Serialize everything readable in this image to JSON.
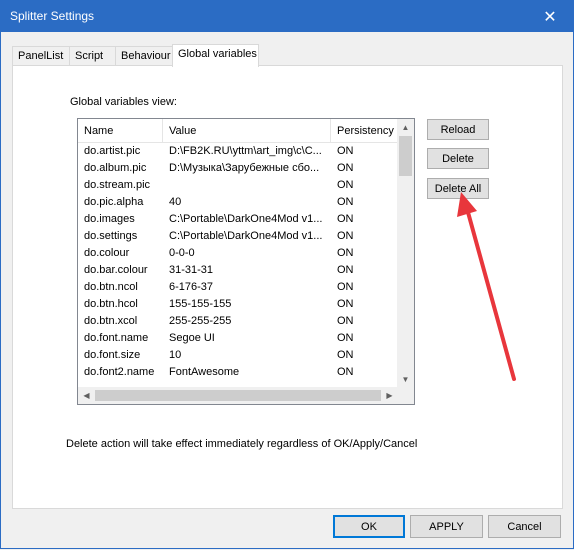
{
  "window": {
    "title": "Splitter Settings"
  },
  "tabs": [
    {
      "label": "PanelList"
    },
    {
      "label": "Script"
    },
    {
      "label": "Behaviour"
    },
    {
      "label": "Global variables"
    }
  ],
  "panel": {
    "view_label": "Global variables view:",
    "note": "Delete action will take effect immediately regardless of OK/Apply/Cancel"
  },
  "list": {
    "columns": [
      "Name",
      "Value",
      "Persistency"
    ],
    "rows": [
      {
        "name": "do.artist.pic",
        "value": "D:\\FB2K.RU\\yttm\\art_img\\c\\C...",
        "persistency": "ON"
      },
      {
        "name": "do.album.pic",
        "value": "D:\\Музыка\\Зарубежные сбо...",
        "persistency": "ON"
      },
      {
        "name": "do.stream.pic",
        "value": "",
        "persistency": "ON"
      },
      {
        "name": "do.pic.alpha",
        "value": "40",
        "persistency": "ON"
      },
      {
        "name": "do.images",
        "value": "C:\\Portable\\DarkOne4Mod v1...",
        "persistency": "ON"
      },
      {
        "name": "do.settings",
        "value": "C:\\Portable\\DarkOne4Mod v1...",
        "persistency": "ON"
      },
      {
        "name": "do.colour",
        "value": "0-0-0",
        "persistency": "ON"
      },
      {
        "name": "do.bar.colour",
        "value": "31-31-31",
        "persistency": "ON"
      },
      {
        "name": "do.btn.ncol",
        "value": "6-176-37",
        "persistency": "ON"
      },
      {
        "name": "do.btn.hcol",
        "value": "155-155-155",
        "persistency": "ON"
      },
      {
        "name": "do.btn.xcol",
        "value": "255-255-255",
        "persistency": "ON"
      },
      {
        "name": "do.font.name",
        "value": "Segoe UI",
        "persistency": "ON"
      },
      {
        "name": "do.font.size",
        "value": "10",
        "persistency": "ON"
      },
      {
        "name": "do.font2.name",
        "value": "FontAwesome",
        "persistency": "ON"
      }
    ]
  },
  "side_buttons": {
    "reload": "Reload",
    "delete": "Delete",
    "delete_all": "Delete All"
  },
  "footer": {
    "ok": "OK",
    "apply": "APPLY",
    "cancel": "Cancel"
  },
  "icons": {
    "close": "close-icon",
    "scroll_up": "arrow-up-icon",
    "scroll_down": "arrow-down-icon",
    "scroll_left": "arrow-left-icon",
    "scroll_right": "arrow-right-icon"
  },
  "colors": {
    "titlebar": "#2b6cc4",
    "annotation_arrow": "#e8363c",
    "default_button_border": "#0078d7"
  }
}
